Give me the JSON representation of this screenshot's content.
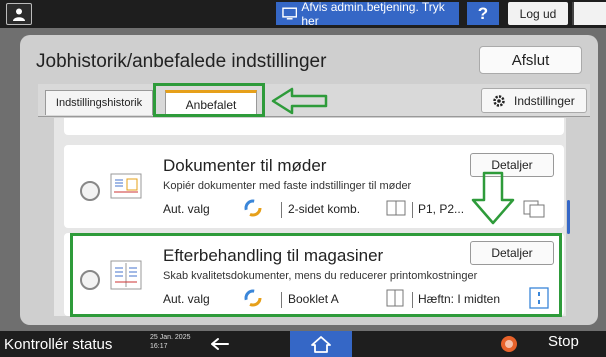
{
  "topbar": {
    "admin_button_label": "Afvis admin.betjening. Tryk her",
    "help_label": "?",
    "logout_label": "Log ud"
  },
  "dialog": {
    "title": "Jobhistorik/anbefalede indstillinger",
    "close_label": "Afslut",
    "tabs": [
      {
        "label": "Indstillingshistorik",
        "active": false
      },
      {
        "label": "Anbefalet",
        "active": true
      }
    ],
    "settings_label": "Indstillinger",
    "items": [
      {
        "title": "Dokumenter til møder",
        "description": "Kopiér dokumenter med faste indstillinger til møder",
        "color_mode": "Aut. valg",
        "option_1": "2-sidet komb.",
        "option_2": "P1, P2...",
        "details_label": "Detaljer"
      },
      {
        "title": "Efterbehandling til magasiner",
        "description": "Skab kvalitetsdokumenter, mens du reducerer printomkostninger",
        "color_mode": "Aut. valg",
        "option_1": "Booklet A",
        "option_2": "Hæftn: I midten",
        "details_label": "Detaljer"
      }
    ]
  },
  "bottombar": {
    "status_label": "Kontrollér status",
    "date": "25 Jan. 2025",
    "time": "16:17",
    "stop_label": "Stop"
  },
  "colors": {
    "accent_blue": "#3567c6",
    "highlight_green": "#2e9b3a",
    "tab_accent": "#e6a01a",
    "stop_orange": "#e8622a"
  },
  "icons": [
    "user-icon",
    "admin-monitor-icon",
    "gear-icon",
    "back-arrow-icon",
    "home-icon",
    "stop-icon",
    "auto-color-icon",
    "annotation-arrow-icon"
  ]
}
